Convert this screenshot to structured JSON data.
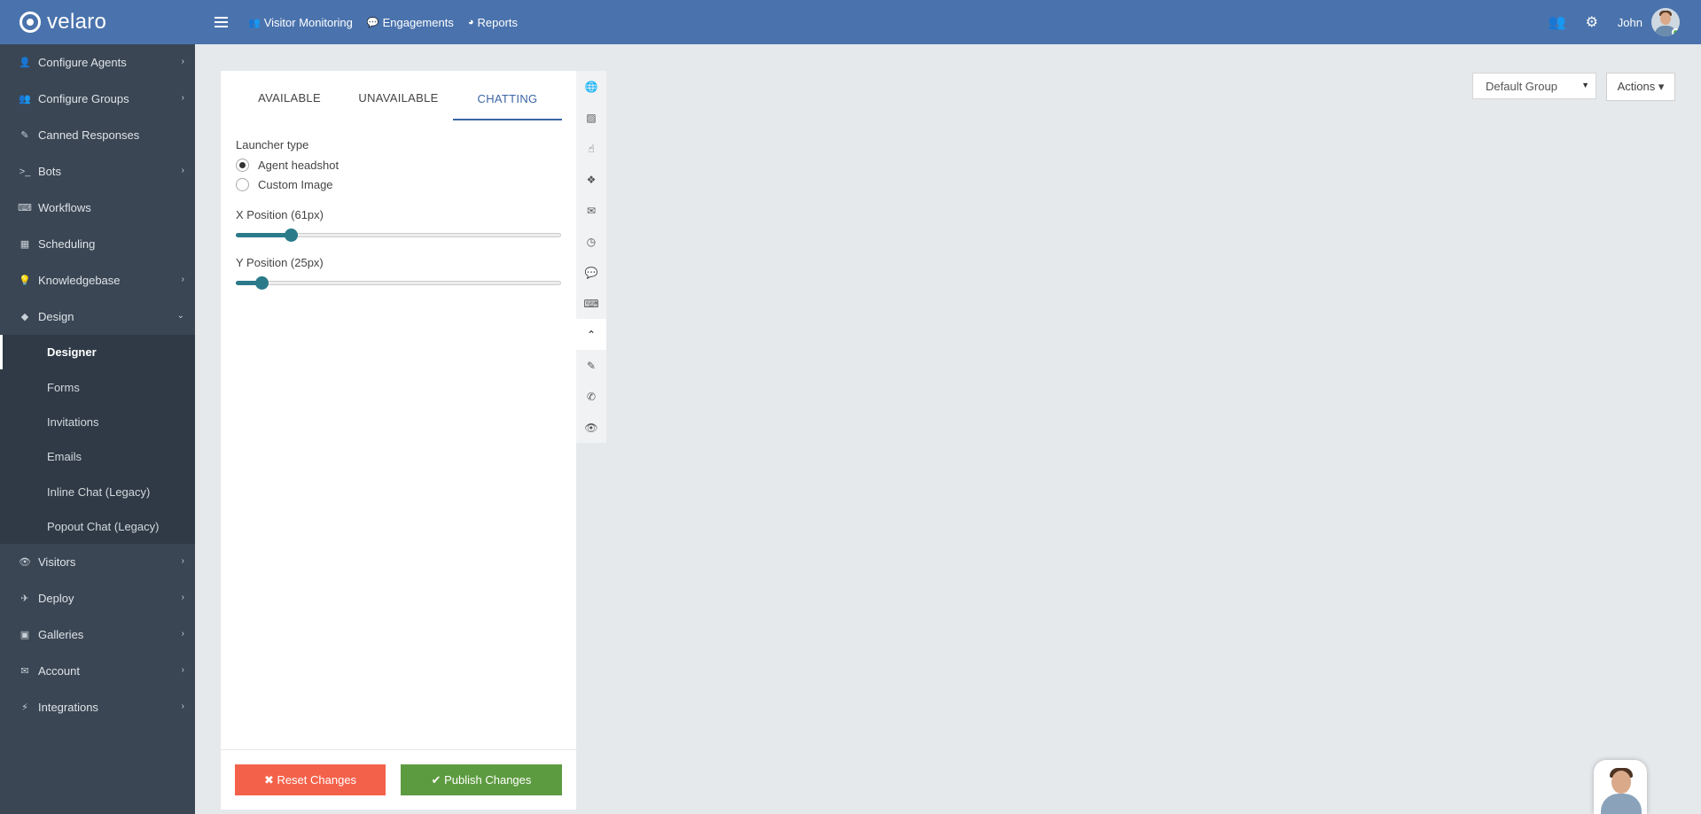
{
  "header": {
    "brand": "velaro",
    "nav": [
      {
        "icon": "users-icon",
        "glyph": "👥",
        "label": "Visitor Monitoring"
      },
      {
        "icon": "chat-icon",
        "glyph": "💬",
        "label": "Engagements"
      },
      {
        "icon": "pie-chart-icon",
        "glyph": "◕",
        "label": "Reports"
      }
    ],
    "user_name": "John"
  },
  "sidebar": {
    "items": [
      {
        "label": "Configure Agents",
        "icon": "user-icon",
        "glyph": "👤",
        "has_chevron": true
      },
      {
        "label": "Configure Groups",
        "icon": "group-icon",
        "glyph": "👥",
        "has_chevron": true
      },
      {
        "label": "Canned Responses",
        "icon": "edit-icon",
        "glyph": "✎",
        "has_chevron": false
      },
      {
        "label": "Bots",
        "icon": "terminal-icon",
        "glyph": ">_",
        "has_chevron": true
      },
      {
        "label": "Workflows",
        "icon": "keyboard-icon",
        "glyph": "⌨",
        "has_chevron": false
      },
      {
        "label": "Scheduling",
        "icon": "calendar-icon",
        "glyph": "▦",
        "has_chevron": false
      },
      {
        "label": "Knowledgebase",
        "icon": "lightbulb-icon",
        "glyph": "💡",
        "has_chevron": true
      },
      {
        "label": "Design",
        "icon": "diamond-icon",
        "glyph": "◆",
        "has_chevron": true
      }
    ],
    "design_sub": [
      "Designer",
      "Forms",
      "Invitations",
      "Emails",
      "Inline Chat (Legacy)",
      "Popout Chat (Legacy)"
    ],
    "items_after": [
      {
        "label": "Visitors",
        "icon": "eye-icon",
        "glyph": "👁"
      },
      {
        "label": "Deploy",
        "icon": "plane-icon",
        "glyph": "✈"
      },
      {
        "label": "Galleries",
        "icon": "image-icon",
        "glyph": "▣"
      },
      {
        "label": "Account",
        "icon": "envelope-icon",
        "glyph": "✉"
      },
      {
        "label": "Integrations",
        "icon": "plug-icon",
        "glyph": "⚡"
      }
    ]
  },
  "panel": {
    "tabs": [
      "AVAILABLE",
      "UNAVAILABLE",
      "CHATTING"
    ],
    "active_tab": 2,
    "launcher_type_label": "Launcher type",
    "launcher_options": [
      "Agent headshot",
      "Custom Image"
    ],
    "selected_option": 0,
    "x_position_label": "X Position (61px)",
    "x_position_value": 0.17,
    "y_position_label": "Y Position (25px)",
    "y_position_value": 0.08,
    "reset_label": "✖ Reset Changes",
    "publish_label": "✔ Publish Changes"
  },
  "rail_icons": [
    {
      "name": "globe-icon",
      "glyph": "🌐"
    },
    {
      "name": "image-icon",
      "glyph": "▨"
    },
    {
      "name": "pointer-icon",
      "glyph": "☝"
    },
    {
      "name": "cubes-icon",
      "glyph": "❖"
    },
    {
      "name": "envelope-icon",
      "glyph": "✉"
    },
    {
      "name": "clock-icon",
      "glyph": "◷"
    },
    {
      "name": "chat-bubble-icon",
      "glyph": "💬"
    },
    {
      "name": "keyboard-icon",
      "glyph": "⌨"
    },
    {
      "name": "launcher-icon",
      "glyph": "⌃"
    },
    {
      "name": "edit-icon",
      "glyph": "✎"
    },
    {
      "name": "phone-icon",
      "glyph": "✆"
    },
    {
      "name": "eye-icon",
      "glyph": "👁"
    }
  ],
  "rail_active": 8,
  "toolbar": {
    "group_select": "Default Group",
    "actions_label": "Actions ▾"
  }
}
